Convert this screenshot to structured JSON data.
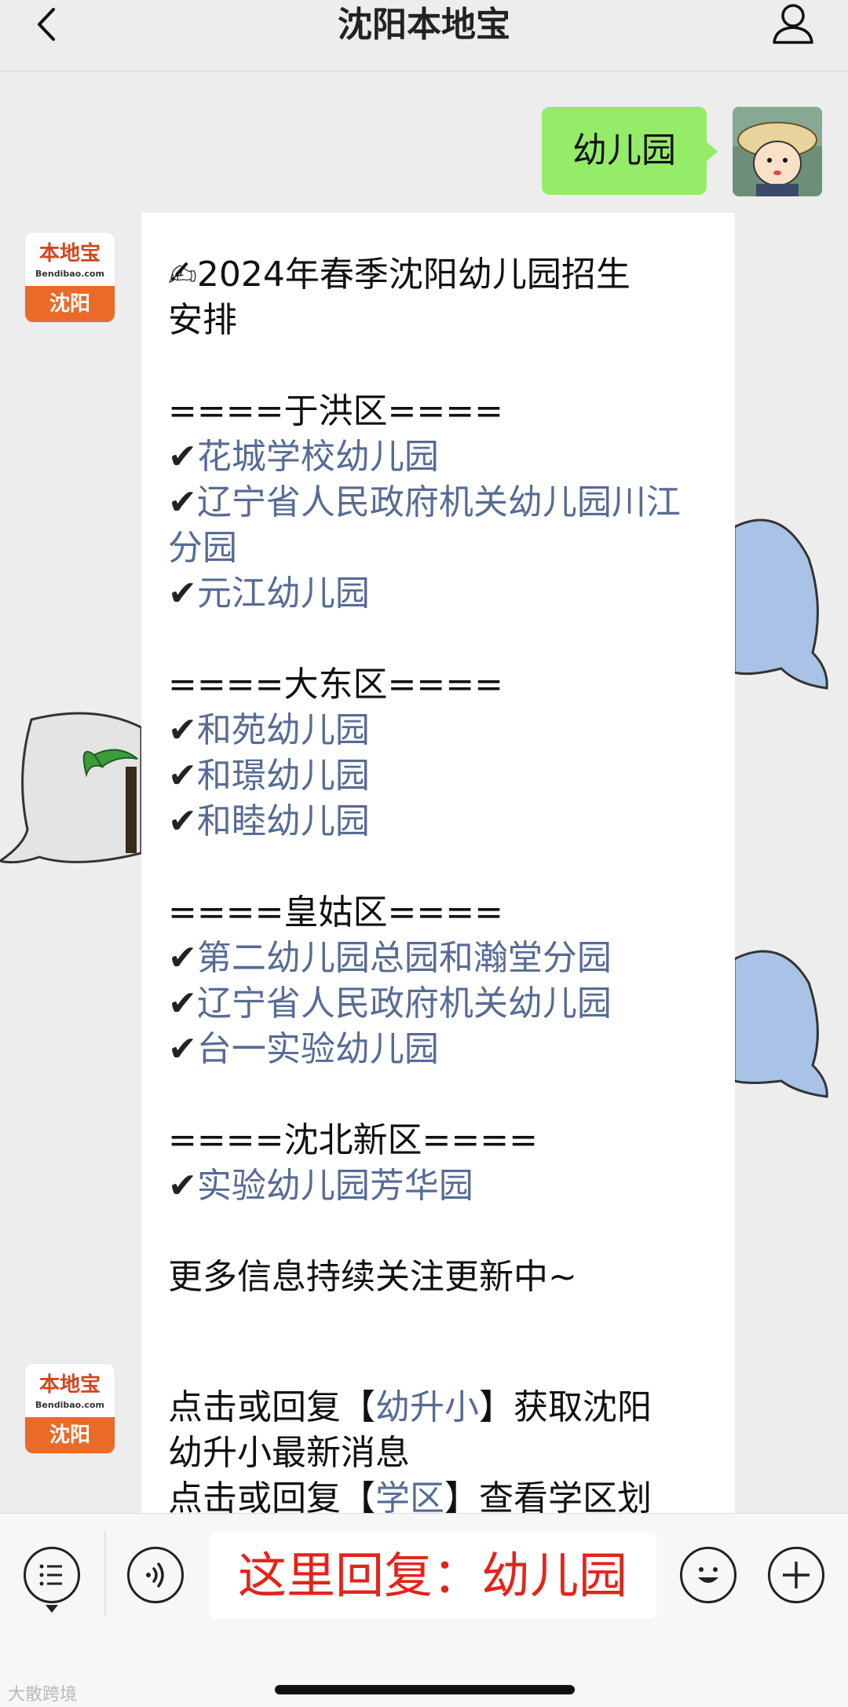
{
  "header": {
    "title": "沈阳本地宝"
  },
  "outgoing": {
    "text": "幼儿园"
  },
  "bot": {
    "brand": "本地宝",
    "domain": "Bendibao.com",
    "city": "沈阳"
  },
  "message1": {
    "title_line1": "✍2024年春季沈阳幼儿园招生",
    "title_line2": "安排",
    "districts": [
      {
        "header": "====于洪区====",
        "items": [
          "花城学校幼儿园",
          "辽宁省人民政府机关幼儿园川江分园",
          "元江幼儿园"
        ]
      },
      {
        "header": "====大东区====",
        "items": [
          "和苑幼儿园",
          "和璟幼儿园",
          "和睦幼儿园"
        ]
      },
      {
        "header": "====皇姑区====",
        "items": [
          "第二幼儿园总园和瀚堂分园",
          "辽宁省人民政府机关幼儿园",
          "台一实验幼儿园"
        ]
      },
      {
        "header": "====沈北新区====",
        "items": [
          "实验幼儿园芳华园"
        ]
      }
    ],
    "check": "✔",
    "footer": "更多信息持续关注更新中~"
  },
  "message2": {
    "line1_pre": "点击或回复【",
    "line1_link": "幼升小",
    "line1_post": "】获取沈阳",
    "line2": "幼升小最新消息",
    "line3_pre": "点击或回复【",
    "line3_link": "学区",
    "line3_post": "】查看学区划"
  },
  "input": {
    "overlay_text": "这里回复：幼儿园"
  },
  "watermark": "大散跨境",
  "icons": {
    "back": "chevron-left-icon",
    "user": "person-icon",
    "menu": "list-menu-icon",
    "voice": "voice-icon",
    "emoji": "smiley-icon",
    "plus": "plus-icon"
  },
  "colors": {
    "accent_link": "#576b95",
    "outgoing_bubble": "#95ec69",
    "overlay_text": "#e3241b",
    "brand_orange": "#ea6a2a"
  }
}
